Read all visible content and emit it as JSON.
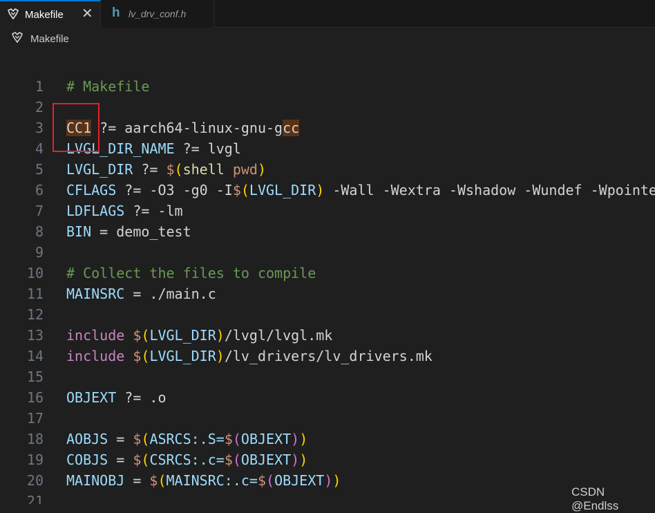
{
  "tabs": [
    {
      "label": "Makefile",
      "active": true,
      "icon": "makefile-icon",
      "close_glyph": "✕"
    },
    {
      "label": "lv_drv_conf.h",
      "active": false,
      "icon": "c-header-icon",
      "icon_glyph": "h"
    }
  ],
  "breadcrumb": {
    "label": "Makefile",
    "icon": "makefile-icon"
  },
  "colors": {
    "comment": "#6a9955",
    "variable": "#9cdcfe",
    "text": "#d4d4d4",
    "keyword": "#c586c0",
    "function": "#dcdcaa",
    "string": "#ce9178",
    "bracket_gold": "#ffd700",
    "bracket_purple": "#da70d6",
    "line_number": "#6e7681",
    "highlight": "#5a3213"
  },
  "lines": [
    [
      [
        "# Makefile",
        "comment"
      ]
    ],
    [],
    [
      [
        "CC1",
        "text",
        "hl"
      ],
      [
        " ?= aarch64-linux-gnu-g",
        "text"
      ],
      [
        "cc",
        "text",
        "hl"
      ]
    ],
    [
      [
        "LVGL_DIR_NAME",
        "variable"
      ],
      [
        " ?= lvgl",
        "text"
      ]
    ],
    [
      [
        "LVGL_DIR",
        "variable"
      ],
      [
        " ?= ",
        "text"
      ],
      [
        "$",
        "string"
      ],
      [
        "(",
        "bracket_gold"
      ],
      [
        "shell",
        "function"
      ],
      [
        " pwd",
        "string"
      ],
      [
        ")",
        "bracket_gold"
      ]
    ],
    [
      [
        "CFLAGS",
        "variable"
      ],
      [
        " ?= -O3 -g0 -I",
        "text"
      ],
      [
        "$",
        "string"
      ],
      [
        "(",
        "bracket_gold"
      ],
      [
        "LVGL_DIR",
        "variable"
      ],
      [
        ")",
        "bracket_gold"
      ],
      [
        " -Wall -Wextra -Wshadow -Wundef -Wpointer-arith",
        "text"
      ]
    ],
    [
      [
        "LDFLAGS",
        "variable"
      ],
      [
        " ?= -lm",
        "text"
      ]
    ],
    [
      [
        "BIN",
        "variable"
      ],
      [
        " = demo_test",
        "text"
      ]
    ],
    [],
    [
      [
        "# Collect the files to compile",
        "comment"
      ]
    ],
    [
      [
        "MAINSRC",
        "variable"
      ],
      [
        " = ./main.c",
        "text"
      ]
    ],
    [],
    [
      [
        "include",
        "keyword"
      ],
      [
        " ",
        "text"
      ],
      [
        "$",
        "string"
      ],
      [
        "(",
        "bracket_gold"
      ],
      [
        "LVGL_DIR",
        "variable"
      ],
      [
        ")",
        "bracket_gold"
      ],
      [
        "/lvgl/lvgl.mk",
        "text"
      ]
    ],
    [
      [
        "include",
        "keyword"
      ],
      [
        " ",
        "text"
      ],
      [
        "$",
        "string"
      ],
      [
        "(",
        "bracket_gold"
      ],
      [
        "LVGL_DIR",
        "variable"
      ],
      [
        ")",
        "bracket_gold"
      ],
      [
        "/lv_drivers/lv_drivers.mk",
        "text"
      ]
    ],
    [],
    [
      [
        "OBJEXT",
        "variable"
      ],
      [
        " ?= .o",
        "text"
      ]
    ],
    [],
    [
      [
        "AOBJS",
        "variable"
      ],
      [
        " = ",
        "text"
      ],
      [
        "$",
        "string"
      ],
      [
        "(",
        "bracket_gold"
      ],
      [
        "ASRCS:.S=",
        "variable"
      ],
      [
        "$",
        "string"
      ],
      [
        "(",
        "bracket_purple"
      ],
      [
        "OBJEXT",
        "variable"
      ],
      [
        ")",
        "bracket_purple"
      ],
      [
        ")",
        "bracket_gold"
      ]
    ],
    [
      [
        "COBJS",
        "variable"
      ],
      [
        " = ",
        "text"
      ],
      [
        "$",
        "string"
      ],
      [
        "(",
        "bracket_gold"
      ],
      [
        "CSRCS:.c=",
        "variable"
      ],
      [
        "$",
        "string"
      ],
      [
        "(",
        "bracket_purple"
      ],
      [
        "OBJEXT",
        "variable"
      ],
      [
        ")",
        "bracket_purple"
      ],
      [
        ")",
        "bracket_gold"
      ]
    ],
    [
      [
        "MAINOBJ",
        "variable"
      ],
      [
        " = ",
        "text"
      ],
      [
        "$",
        "string"
      ],
      [
        "(",
        "bracket_gold"
      ],
      [
        "MAINSRC:.c=",
        "variable"
      ],
      [
        "$",
        "string"
      ],
      [
        "(",
        "bracket_purple"
      ],
      [
        "OBJEXT",
        "variable"
      ],
      [
        ")",
        "bracket_purple"
      ],
      [
        ")",
        "bracket_gold"
      ]
    ],
    []
  ],
  "watermark": "CSDN @Endlss"
}
